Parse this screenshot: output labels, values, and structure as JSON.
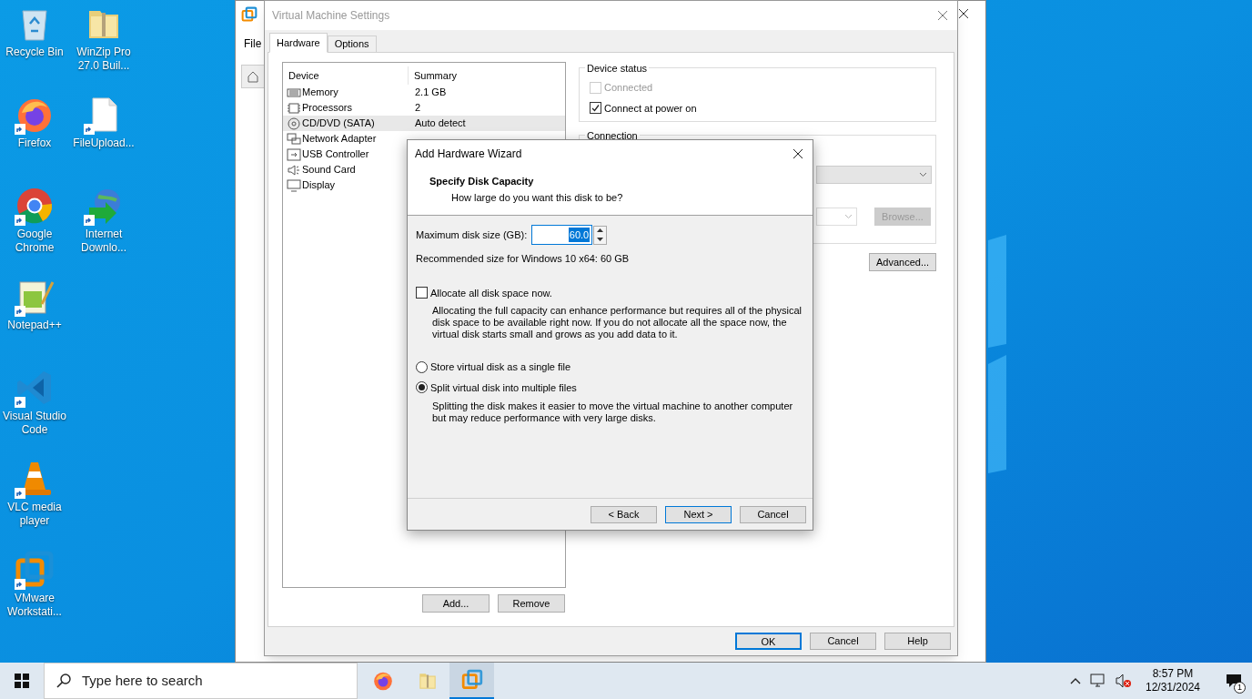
{
  "desktop_icons": [
    {
      "label": "Recycle Bin",
      "kind": "recycle",
      "shortcut": false
    },
    {
      "label": "WinZip Pro 27.0 Buil...",
      "kind": "folder",
      "shortcut": false
    },
    {
      "label": "Firefox",
      "kind": "firefox",
      "shortcut": true
    },
    {
      "label": "FileUpload...",
      "kind": "file",
      "shortcut": true
    },
    {
      "label": "Google Chrome",
      "kind": "chrome",
      "shortcut": true
    },
    {
      "label": "Internet Downlo...",
      "kind": "globe",
      "shortcut": true
    },
    {
      "label": "Notepad++",
      "kind": "notepad",
      "shortcut": true
    },
    {
      "label": "Visual Studio Code",
      "kind": "vscode",
      "shortcut": true
    },
    {
      "label": "VLC media player",
      "kind": "cone",
      "shortcut": true
    },
    {
      "label": "VMware Workstati...",
      "kind": "vmware",
      "shortcut": true
    }
  ],
  "background_window": {
    "menu": [
      "File"
    ]
  },
  "settings": {
    "title": "Virtual Machine Settings",
    "tabs": [
      {
        "label": "Hardware",
        "selected": true
      },
      {
        "label": "Options",
        "selected": false
      }
    ],
    "device_table": {
      "columns": [
        "Device",
        "Summary"
      ],
      "rows": [
        {
          "device": "Memory",
          "summary": "2.1 GB",
          "kind": "memory",
          "selected": false
        },
        {
          "device": "Processors",
          "summary": "2",
          "kind": "cpu",
          "selected": false
        },
        {
          "device": "CD/DVD (SATA)",
          "summary": "Auto detect",
          "kind": "disc",
          "selected": true
        },
        {
          "device": "Network Adapter",
          "kind": "network",
          "selected": false
        },
        {
          "device": "USB Controller",
          "kind": "usb",
          "selected": false
        },
        {
          "device": "Sound Card",
          "kind": "sound",
          "selected": false
        },
        {
          "device": "Display",
          "kind": "display",
          "selected": false
        }
      ]
    },
    "list_buttons": [
      "Add...",
      "Remove"
    ],
    "device_status": {
      "title": "Device status",
      "options": [
        {
          "label": "Connected",
          "checked": false,
          "disabled": true
        },
        {
          "label": "Connect at power on",
          "checked": true,
          "disabled": false
        }
      ]
    },
    "connection": {
      "title": "Connection",
      "browse": "Browse...",
      "browse_disabled": true
    },
    "advanced": "Advanced...",
    "buttons": [
      {
        "label": "OK",
        "default": true
      },
      {
        "label": "Cancel",
        "default": false
      },
      {
        "label": "Help",
        "default": false
      }
    ]
  },
  "wizard": {
    "title": "Add Hardware Wizard",
    "heading": "Specify Disk Capacity",
    "subheading": "How large do you want this disk to be?",
    "size_label": "Maximum disk size (GB):",
    "size_value": "60.0",
    "recommended": "Recommended size for Windows 10 x64: 60 GB",
    "allocate": {
      "label": "Allocate all disk space now.",
      "checked": false
    },
    "allocate_help": "Allocating the full capacity can enhance performance but requires all of the physical disk space to be available right now. If you do not allocate all the space now, the virtual disk starts small and grows as you add data to it.",
    "storage_options": [
      {
        "label": "Store virtual disk as a single file",
        "selected": false
      },
      {
        "label": "Split virtual disk into multiple files",
        "selected": true
      }
    ],
    "split_help": "Splitting the disk makes it easier to move the virtual machine to another computer but may reduce performance with very large disks.",
    "buttons": [
      {
        "label": "< Back",
        "default": false
      },
      {
        "label": "Next >",
        "default": true
      },
      {
        "label": "Cancel",
        "default": false
      }
    ]
  },
  "taskbar": {
    "search_placeholder": "Type here to search",
    "apps": [
      {
        "kind": "firefox",
        "selected": false
      },
      {
        "kind": "folder",
        "selected": false
      },
      {
        "kind": "vmware",
        "selected": true
      }
    ],
    "time": "8:57 PM",
    "date": "12/31/2024",
    "notifications": "1"
  }
}
